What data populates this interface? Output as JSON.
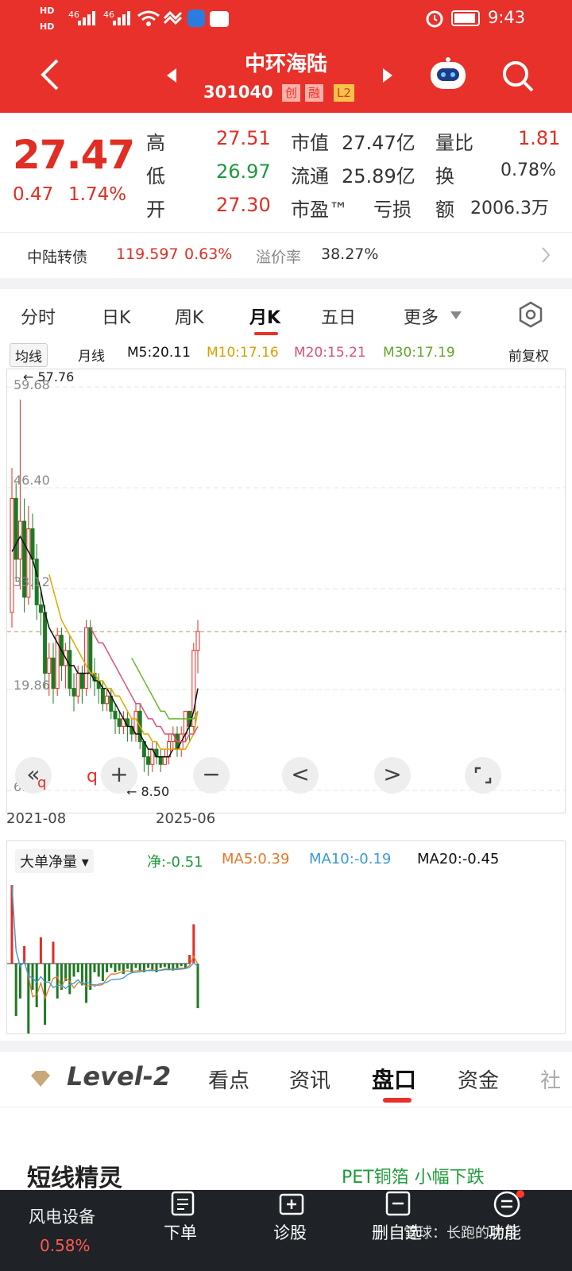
{
  "status": {
    "time": "9:43",
    "net1": "46",
    "net2": "46",
    "hd1": "HD",
    "hd2": "HD"
  },
  "header": {
    "name": "中环海陆",
    "code": "301040",
    "badges": [
      "创",
      "融",
      "L2"
    ]
  },
  "quote": {
    "price": "27.47",
    "change": "0.47",
    "change_pct": "1.74%",
    "high_label": "高",
    "high": "27.51",
    "low_label": "低",
    "low": "26.97",
    "open_label": "开",
    "open": "27.30",
    "mktcap_label": "市值",
    "mktcap": "27.47亿",
    "float_label": "流通",
    "float": "25.89亿",
    "pe_label": "市盈™",
    "pe": "亏损",
    "vr_label": "量比",
    "vr": "1.81",
    "turnover_label": "换",
    "turnover": "0.78%",
    "amount_label": "额",
    "amount": "2006.3万"
  },
  "bond": {
    "name": "中陆转债",
    "price": "119.597",
    "pct": "0.63%",
    "premium_label": "溢价率",
    "premium": "38.27%"
  },
  "tabs": [
    "分时",
    "日K",
    "周K",
    "月K",
    "五日",
    "更多"
  ],
  "active_tab": "月K",
  "ma": {
    "type": "均线",
    "period": "月线",
    "m5": "M5:20.11",
    "m10": "M10:17.16",
    "m20": "M20:15.21",
    "m30": "M30:17.19",
    "adjust": "前复权"
  },
  "colors": {
    "red": "#e8312a",
    "up": "#e02e24",
    "down": "#1e7a22",
    "m5": "#111111",
    "m10": "#e0a800",
    "m20": "#e0507a",
    "m30": "#6ab82a"
  },
  "kchart": {
    "y_labels": [
      "59.68",
      "46.40",
      "33.12",
      "19.86",
      "6.58"
    ],
    "max_label": "57.76",
    "min_label": "8.50",
    "dashed_value": "27.47",
    "x_start": "2021-08",
    "x_end": "2025-06"
  },
  "controls": {
    "zoom_out": "«",
    "q1": "q",
    "q2": "q",
    "plus": "+",
    "minus": "−",
    "prev": "<",
    "next": ">",
    "fullscreen": "⌟"
  },
  "indicator": {
    "name": "大单净量",
    "net": "净:-0.51",
    "ma5": "MA5:0.39",
    "ma10": "MA10:-0.19",
    "ma20": "MA20:-0.45"
  },
  "bottom_tabs": {
    "level2": "Level-2",
    "items": [
      "看点",
      "资讯",
      "盘口",
      "资金",
      "社"
    ],
    "active": "盘口"
  },
  "promo": {
    "title": "短线精灵",
    "right": "PET铜箔 小幅下跌"
  },
  "bottom_nav": {
    "sector": "风电设备",
    "sector_pct": "0.58%",
    "items": [
      "下单",
      "诊股",
      "删自选",
      "功能"
    ],
    "watermark": "雪球：长跑的胖月"
  },
  "chart_data": {
    "type": "candlestick",
    "title": "中环海陆 月K",
    "x_range": [
      "2021-08",
      "2025-06"
    ],
    "ylim": [
      6.58,
      59.68
    ],
    "max_high": 57.76,
    "min_low": 8.5,
    "last_close": 27.47,
    "ma": {
      "M5": 20.11,
      "M10": 17.16,
      "M20": 15.21,
      "M30": 17.19
    },
    "candles": [
      [
        30,
        45,
        28,
        49
      ],
      [
        45,
        37,
        34,
        47
      ],
      [
        37,
        42,
        33,
        58
      ],
      [
        42,
        32,
        30,
        45
      ],
      [
        32,
        41,
        31,
        44
      ],
      [
        41,
        37,
        33,
        43
      ],
      [
        37,
        31,
        29,
        39
      ],
      [
        31,
        30,
        27,
        33
      ],
      [
        30,
        22,
        20,
        31
      ],
      [
        22,
        24,
        19,
        26
      ],
      [
        24,
        20,
        18,
        26
      ],
      [
        20,
        27,
        19,
        28
      ],
      [
        27,
        23,
        21,
        28
      ],
      [
        23,
        25,
        20,
        26
      ],
      [
        25,
        20,
        19,
        27
      ],
      [
        20,
        19,
        17,
        22
      ],
      [
        19,
        22,
        18,
        23
      ],
      [
        22,
        20,
        18,
        23
      ],
      [
        20,
        28,
        19,
        29
      ],
      [
        28,
        22,
        20,
        29
      ],
      [
        22,
        21,
        19,
        24
      ],
      [
        21,
        20,
        18,
        22
      ],
      [
        20,
        18,
        17,
        21
      ],
      [
        18,
        19,
        17,
        20
      ],
      [
        19,
        17,
        16,
        20
      ],
      [
        17,
        16,
        14,
        18
      ],
      [
        16,
        15,
        14,
        17
      ],
      [
        15,
        16,
        14,
        17
      ],
      [
        16,
        15,
        13,
        17
      ],
      [
        15,
        14,
        13,
        16
      ],
      [
        14,
        17,
        13,
        18
      ],
      [
        17,
        13,
        12,
        18
      ],
      [
        13,
        11,
        9,
        13
      ],
      [
        11,
        10,
        8.5,
        12
      ],
      [
        10,
        12,
        9,
        13
      ],
      [
        12,
        11,
        10,
        13
      ],
      [
        11,
        10,
        9,
        12
      ],
      [
        10,
        11,
        10,
        12
      ],
      [
        11,
        13,
        10,
        14
      ],
      [
        13,
        14,
        12,
        15
      ],
      [
        14,
        12,
        11,
        15
      ],
      [
        12,
        14,
        11,
        15
      ],
      [
        14,
        17,
        13,
        17
      ],
      [
        17,
        15,
        13,
        17
      ],
      [
        15,
        25,
        14,
        26
      ],
      [
        25,
        27.5,
        22,
        29
      ]
    ],
    "m5": [
      38,
      39,
      40,
      39,
      38,
      37,
      35,
      33,
      30,
      28,
      27,
      26,
      25,
      24,
      23,
      23,
      22,
      22,
      22,
      22,
      21,
      21,
      20,
      20,
      19,
      18,
      17,
      16,
      15,
      15,
      14,
      14,
      13,
      12,
      12,
      11,
      11,
      11,
      11,
      12,
      12,
      13,
      14,
      15,
      17,
      20
    ],
    "m10": [
      null,
      null,
      null,
      null,
      null,
      null,
      null,
      null,
      null,
      35,
      33,
      31,
      29,
      28,
      27,
      26,
      25,
      24,
      23,
      22,
      22,
      21,
      21,
      20,
      20,
      19,
      19,
      18,
      17,
      16,
      16,
      15,
      14,
      14,
      13,
      13,
      12,
      12,
      12,
      12,
      12,
      12,
      12,
      13,
      14,
      17
    ],
    "m20": [
      null,
      null,
      null,
      null,
      null,
      null,
      null,
      null,
      null,
      null,
      null,
      null,
      null,
      null,
      null,
      null,
      null,
      null,
      null,
      28,
      27,
      26,
      26,
      25,
      24,
      23,
      22,
      21,
      20,
      19,
      18,
      18,
      17,
      16,
      16,
      15,
      15,
      14,
      14,
      14,
      13,
      13,
      13,
      14,
      14,
      15
    ],
    "m30": [
      null,
      null,
      null,
      null,
      null,
      null,
      null,
      null,
      null,
      null,
      null,
      null,
      null,
      null,
      null,
      null,
      null,
      null,
      null,
      null,
      null,
      null,
      null,
      null,
      null,
      null,
      null,
      null,
      null,
      24,
      23,
      22,
      21,
      20,
      19,
      18,
      17,
      17,
      16,
      16,
      16,
      16,
      16,
      16,
      16,
      17
    ],
    "volume_net": [
      0.9,
      -0.6,
      -0.4,
      0.2,
      -0.8,
      -0.3,
      -0.5,
      0.3,
      -0.7,
      -0.2,
      0.25,
      -0.4,
      -0.3,
      -0.2,
      -0.35,
      -0.15,
      -0.1,
      -0.25,
      -0.45,
      -0.3,
      -0.1,
      -0.15,
      -0.2,
      -0.1,
      -0.05,
      -0.1,
      -0.08,
      -0.12,
      -0.06,
      -0.1,
      -0.05,
      -0.08,
      -0.1,
      -0.05,
      -0.07,
      -0.1,
      -0.05,
      -0.04,
      -0.06,
      -0.08,
      -0.05,
      -0.03,
      -0.05,
      0.1,
      0.45,
      -0.51
    ]
  }
}
